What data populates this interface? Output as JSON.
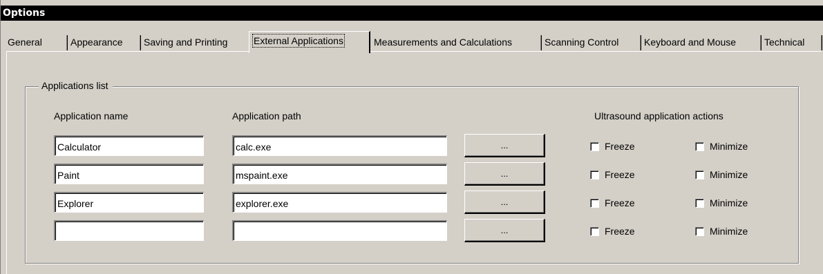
{
  "window": {
    "title": "Options"
  },
  "tabs": [
    {
      "label": "General",
      "active": false
    },
    {
      "label": "Appearance",
      "active": false
    },
    {
      "label": "Saving and Printing",
      "active": false
    },
    {
      "label": "External Applications",
      "active": true
    },
    {
      "label": "Measurements and Calculations",
      "active": false
    },
    {
      "label": "Scanning Control",
      "active": false
    },
    {
      "label": "Keyboard and Mouse",
      "active": false
    },
    {
      "label": "Technical",
      "active": false
    }
  ],
  "group": {
    "title": "Applications list",
    "col_name": "Application name",
    "col_path": "Application path",
    "col_actions": "Ultrasound application actions"
  },
  "rows": [
    {
      "name": "Calculator",
      "path": "calc.exe",
      "browse": "...",
      "freeze_label": "Freeze",
      "freeze_checked": false,
      "minimize_label": "Minimize",
      "minimize_checked": false
    },
    {
      "name": "Paint",
      "path": "mspaint.exe",
      "browse": "...",
      "freeze_label": "Freeze",
      "freeze_checked": false,
      "minimize_label": "Minimize",
      "minimize_checked": false
    },
    {
      "name": "Explorer",
      "path": "explorer.exe",
      "browse": "...",
      "freeze_label": "Freeze",
      "freeze_checked": false,
      "minimize_label": "Minimize",
      "minimize_checked": false
    },
    {
      "name": "",
      "path": "",
      "browse": "...",
      "freeze_label": "Freeze",
      "freeze_checked": false,
      "minimize_label": "Minimize",
      "minimize_checked": false
    }
  ],
  "colors": {
    "face": "#d4d0c8",
    "titlebar": "#000000",
    "titletext": "#ffffff"
  }
}
